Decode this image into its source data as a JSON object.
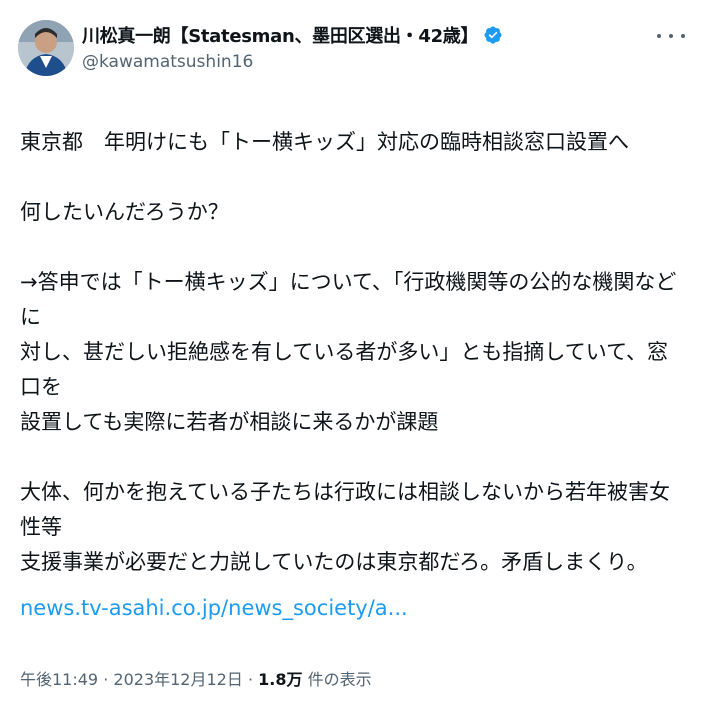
{
  "author": {
    "display_name": "川松真一朗【Statesman、墨田区選出・42歳】",
    "handle": "@kawamatsushin16",
    "verified_color": "#1d9bf0"
  },
  "tweet": {
    "paragraphs": [
      [
        "東京都　年明けにも「トー横キッズ」対応の臨時相談窓口設置へ"
      ],
      [
        "何したいんだろうか？"
      ],
      [
        "→答申では「トー横キッズ」について、「行政機関等の公的な機関などに",
        "対し、甚だしい拒絶感を有している者が多い」とも指摘していて、窓口を",
        "設置しても実際に若者が相談に来るかが課題"
      ],
      [
        "大体、何かを抱えている子たちは行政には相談しないから若年被害女性等",
        "支援事業が必要だと力説していたのは東京都だろ。矛盾しまくり。"
      ]
    ],
    "link": "news.tv-asahi.co.jp/news_society/a...",
    "time": "午後11:49",
    "separator": "·",
    "date": "2023年12月12日",
    "views_count": "1.8万",
    "views_label": "件の表示"
  },
  "icons": {
    "more": "more-horizontal-icon",
    "verified": "verified-badge-icon"
  }
}
